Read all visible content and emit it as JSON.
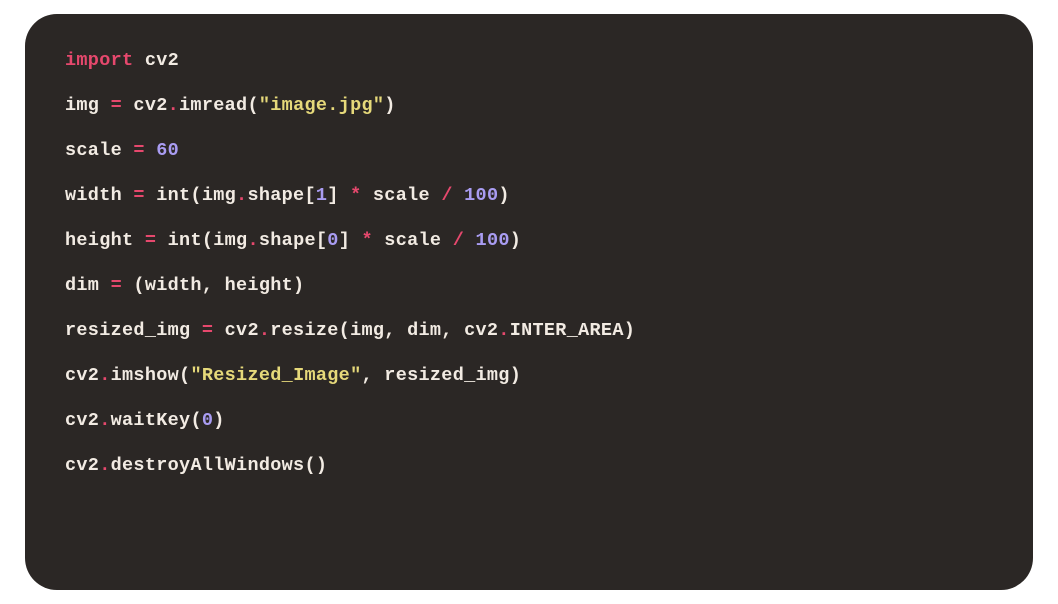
{
  "code": {
    "line1": {
      "t1": "import",
      "t2": " cv2"
    },
    "line2": {
      "t1": "img ",
      "t2": "=",
      "t3": " cv2",
      "t4": ".",
      "t5": "imread(",
      "t6": "\"image.jpg\"",
      "t7": ")"
    },
    "line3": {
      "t1": "scale ",
      "t2": "=",
      "t3": " ",
      "t4": "60"
    },
    "line4": {
      "t1": "width ",
      "t2": "=",
      "t3": " int(img",
      "t4": ".",
      "t5": "shape[",
      "t6": "1",
      "t7": "] ",
      "t8": "*",
      "t9": " scale ",
      "t10": "/",
      "t11": " ",
      "t12": "100",
      "t13": ")"
    },
    "line5": {
      "t1": "height ",
      "t2": "=",
      "t3": " int(img",
      "t4": ".",
      "t5": "shape[",
      "t6": "0",
      "t7": "] ",
      "t8": "*",
      "t9": " scale ",
      "t10": "/",
      "t11": " ",
      "t12": "100",
      "t13": ")"
    },
    "line6": {
      "t1": "dim ",
      "t2": "=",
      "t3": " (width, height)"
    },
    "line7": {
      "t1": "resized_img ",
      "t2": "=",
      "t3": " cv2",
      "t4": ".",
      "t5": "resize(img, dim, cv2",
      "t6": ".",
      "t7": "INTER_AREA)"
    },
    "line8": {
      "t1": "cv2",
      "t2": ".",
      "t3": "imshow(",
      "t4": "\"Resized_Image\"",
      "t5": ", resized_img)"
    },
    "line9": {
      "t1": "cv2",
      "t2": ".",
      "t3": "waitKey(",
      "t4": "0",
      "t5": ")"
    },
    "line10": {
      "t1": "cv2",
      "t2": ".",
      "t3": "destroyAllWindows()"
    }
  }
}
